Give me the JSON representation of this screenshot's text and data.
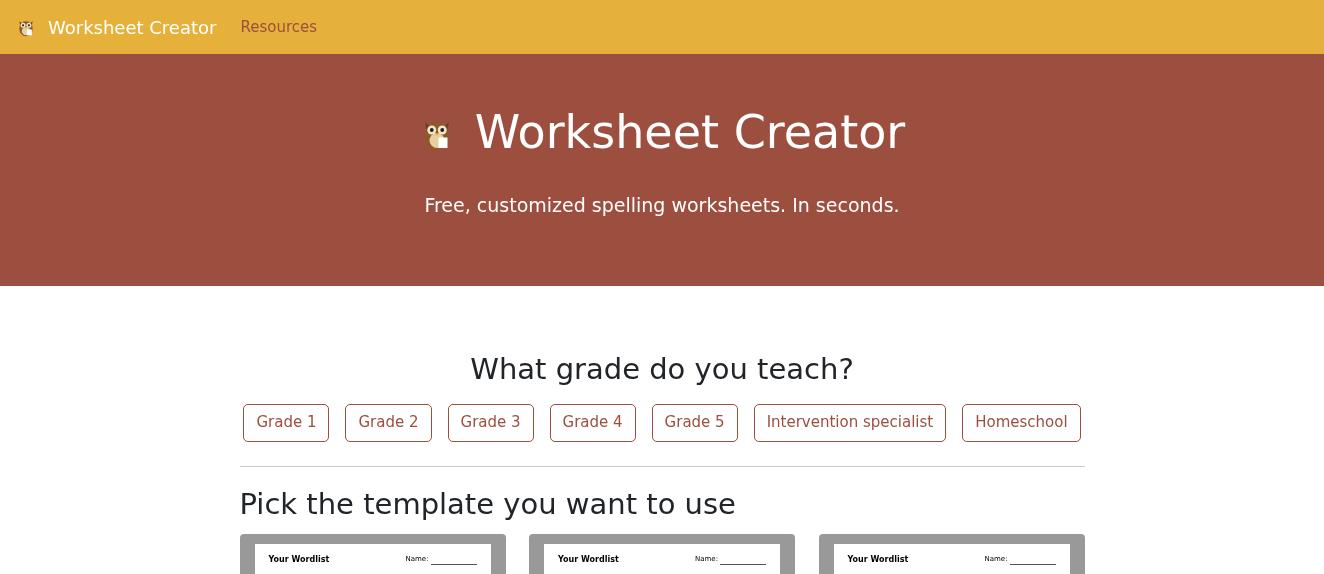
{
  "navbar": {
    "brand": "Worksheet Creator",
    "links": [
      "Resources"
    ]
  },
  "hero": {
    "title": "Worksheet Creator",
    "subtitle": "Free, customized spelling worksheets. In seconds."
  },
  "grade_section": {
    "heading": "What grade do you teach?",
    "options": [
      "Grade 1",
      "Grade 2",
      "Grade 3",
      "Grade 4",
      "Grade 5",
      "Intervention specialist",
      "Homeschool"
    ]
  },
  "template_section": {
    "heading": "Pick the template you want to use",
    "templates": [
      {
        "title": "Your Wordlist",
        "name_label": "Name:"
      },
      {
        "title": "Your Wordlist",
        "name_label": "Name:"
      },
      {
        "title": "Your Wordlist",
        "name_label": "Name:"
      }
    ]
  }
}
